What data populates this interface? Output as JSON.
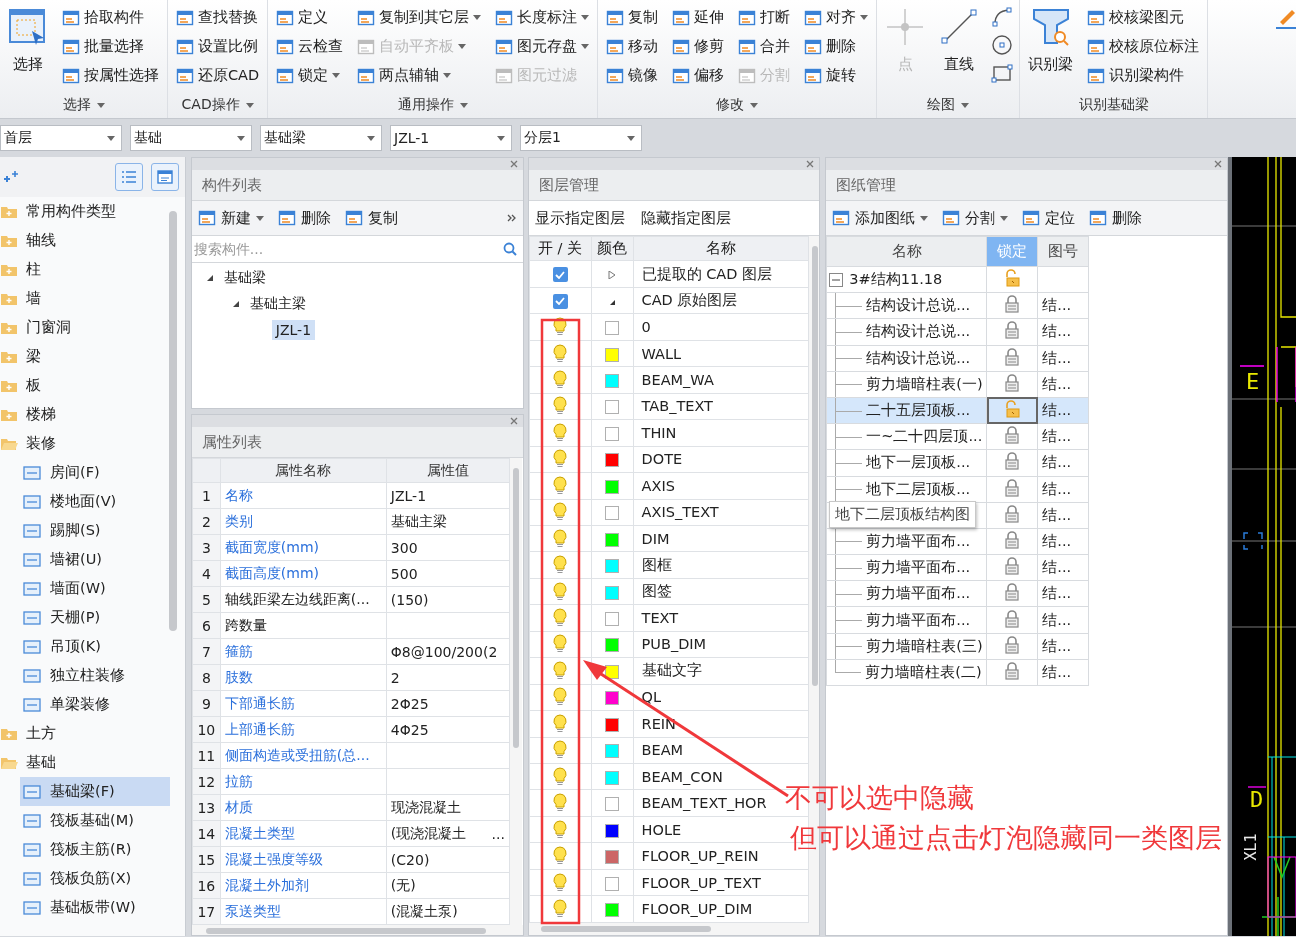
{
  "ribbon": {
    "groups": [
      {
        "label": "选择",
        "menu": true,
        "large": [
          {
            "label": "选择",
            "disabled": false
          }
        ],
        "columns": [
          [
            {
              "kind": "tool",
              "label": "拾取构件",
              "dropdown": false,
              "disabled": false
            },
            {
              "kind": "tool",
              "label": "批量选择",
              "dropdown": false,
              "disabled": false
            },
            {
              "kind": "tool",
              "label": "按属性选择",
              "dropdown": false,
              "disabled": false
            }
          ]
        ]
      },
      {
        "label": "CAD操作",
        "menu": true,
        "columns": [
          [
            {
              "kind": "tool",
              "label": "查找替换",
              "dropdown": false,
              "disabled": false
            },
            {
              "kind": "tool",
              "label": "设置比例",
              "dropdown": false,
              "disabled": false
            },
            {
              "kind": "tool",
              "label": "还原CAD",
              "dropdown": false,
              "disabled": false
            }
          ]
        ]
      },
      {
        "label": "通用操作",
        "menu": true,
        "columns": [
          [
            {
              "kind": "tool",
              "label": "定义",
              "dropdown": false,
              "disabled": false
            },
            {
              "kind": "tool",
              "label": "云检查",
              "dropdown": false,
              "disabled": false
            },
            {
              "kind": "tool",
              "label": "锁定",
              "dropdown": true,
              "disabled": false
            }
          ],
          [
            {
              "kind": "tool",
              "label": "复制到其它层",
              "dropdown": true,
              "disabled": false
            },
            {
              "kind": "tool",
              "label": "自动平齐板",
              "dropdown": true,
              "disabled": true
            },
            {
              "kind": "tool",
              "label": "两点辅轴",
              "dropdown": true,
              "disabled": false
            }
          ],
          [
            {
              "kind": "tool",
              "label": "长度标注",
              "dropdown": true,
              "disabled": false
            },
            {
              "kind": "tool",
              "label": "图元存盘",
              "dropdown": true,
              "disabled": false
            },
            {
              "kind": "tool",
              "label": "图元过滤",
              "dropdown": false,
              "disabled": true
            }
          ]
        ]
      },
      {
        "label": "修改",
        "menu": true,
        "columns": [
          [
            {
              "kind": "tool",
              "label": "复制",
              "dropdown": false,
              "disabled": false
            },
            {
              "kind": "tool",
              "label": "移动",
              "dropdown": false,
              "disabled": false
            },
            {
              "kind": "tool",
              "label": "镜像",
              "dropdown": false,
              "disabled": false
            }
          ],
          [
            {
              "kind": "tool",
              "label": "延伸",
              "dropdown": false,
              "disabled": false
            },
            {
              "kind": "tool",
              "label": "修剪",
              "dropdown": false,
              "disabled": false
            },
            {
              "kind": "tool",
              "label": "偏移",
              "dropdown": false,
              "disabled": false
            }
          ],
          [
            {
              "kind": "tool",
              "label": "打断",
              "dropdown": false,
              "disabled": false
            },
            {
              "kind": "tool",
              "label": "合并",
              "dropdown": false,
              "disabled": false
            },
            {
              "kind": "tool",
              "label": "分割",
              "dropdown": false,
              "disabled": true
            }
          ],
          [
            {
              "kind": "tool",
              "label": "对齐",
              "dropdown": true,
              "disabled": false
            },
            {
              "kind": "tool",
              "label": "删除",
              "dropdown": false,
              "disabled": false
            },
            {
              "kind": "tool",
              "label": "旋转",
              "dropdown": false,
              "disabled": false
            }
          ]
        ]
      },
      {
        "label": "绘图",
        "menu": true,
        "large": [
          {
            "label": "点",
            "disabled": true
          },
          {
            "label": "直线",
            "disabled": false
          }
        ],
        "columns": [
          [
            {
              "kind": "icon"
            },
            {
              "kind": "icon"
            },
            {
              "kind": "icon"
            }
          ]
        ]
      },
      {
        "label": "识别基础梁",
        "menu": false,
        "large": [
          {
            "label": "识别梁",
            "disabled": false
          }
        ],
        "columns": [
          [
            {
              "kind": "tool",
              "label": "校核梁图元",
              "dropdown": false,
              "disabled": false
            },
            {
              "kind": "tool",
              "label": "校核原位标注",
              "dropdown": false,
              "disabled": false
            },
            {
              "kind": "tool",
              "label": "识别梁构件",
              "dropdown": false,
              "disabled": false
            }
          ]
        ]
      }
    ]
  },
  "selectors": [
    "首层",
    "基础",
    "基础梁",
    "JZL-1",
    "分层1"
  ],
  "tree": {
    "items": [
      {
        "label": "常用构件类型",
        "expanded": false,
        "selected": false
      },
      {
        "label": "轴线",
        "expanded": false,
        "selected": false
      },
      {
        "label": "柱",
        "expanded": false,
        "selected": false
      },
      {
        "label": "墙",
        "expanded": false,
        "selected": false
      },
      {
        "label": "门窗洞",
        "expanded": false,
        "selected": false
      },
      {
        "label": "梁",
        "expanded": false,
        "selected": false
      },
      {
        "label": "板",
        "expanded": false,
        "selected": false
      },
      {
        "label": "楼梯",
        "expanded": false,
        "selected": false
      },
      {
        "label": "装修",
        "expanded": true,
        "selected": false,
        "children": [
          {
            "label": "房间(F)",
            "selected": false
          },
          {
            "label": "楼地面(V)",
            "selected": false
          },
          {
            "label": "踢脚(S)",
            "selected": false
          },
          {
            "label": "墙裙(U)",
            "selected": false
          },
          {
            "label": "墙面(W)",
            "selected": false
          },
          {
            "label": "天棚(P)",
            "selected": false
          },
          {
            "label": "吊顶(K)",
            "selected": false
          },
          {
            "label": "独立柱装修",
            "selected": false
          },
          {
            "label": "单梁装修",
            "selected": false
          }
        ]
      },
      {
        "label": "土方",
        "expanded": false,
        "selected": false
      },
      {
        "label": "基础",
        "expanded": true,
        "selected": false,
        "children": [
          {
            "label": "基础梁(F)",
            "selected": true
          },
          {
            "label": "筏板基础(M)",
            "selected": false
          },
          {
            "label": "筏板主筋(R)",
            "selected": false
          },
          {
            "label": "筏板负筋(X)",
            "selected": false
          },
          {
            "label": "基础板带(W)",
            "selected": false
          }
        ]
      }
    ]
  },
  "component_list": {
    "title": "构件列表",
    "toolbar": [
      {
        "label": "新建",
        "dropdown": true
      },
      {
        "label": "删除",
        "dropdown": false
      },
      {
        "label": "复制",
        "dropdown": false
      }
    ],
    "search": {
      "placeholder": "搜索构件..."
    },
    "tree": [
      {
        "label": "基础梁",
        "expanded": true,
        "selected": false,
        "children": [
          {
            "label": "基础主梁",
            "expanded": true,
            "selected": false,
            "children": [
              {
                "label": "JZL-1",
                "selected": true
              }
            ]
          }
        ]
      }
    ]
  },
  "properties": {
    "title": "属性列表",
    "columns": [
      "属性名称",
      "属性值"
    ],
    "rows": [
      {
        "index": "1",
        "name": "名称",
        "value": "JZL-1",
        "public": true
      },
      {
        "index": "2",
        "name": "类别",
        "value": "基础主梁",
        "public": true
      },
      {
        "index": "3",
        "name": "截面宽度(mm)",
        "value": "300",
        "public": true
      },
      {
        "index": "4",
        "name": "截面高度(mm)",
        "value": "500",
        "public": true
      },
      {
        "index": "5",
        "name": "轴线距梁左边线距离(...",
        "value": "(150)",
        "public": false
      },
      {
        "index": "6",
        "name": "跨数量",
        "public": false
      },
      {
        "index": "7",
        "name": "箍筋",
        "value": "Φ8@100/200(2",
        "public": true
      },
      {
        "index": "8",
        "name": "肢数",
        "value": "2",
        "public": true
      },
      {
        "index": "9",
        "name": "下部通长筋",
        "value": "2Φ25",
        "public": true
      },
      {
        "index": "10",
        "name": "上部通长筋",
        "value": "4Φ25",
        "public": true
      },
      {
        "index": "11",
        "name": "侧面构造或受扭筋(总...",
        "public": true
      },
      {
        "index": "12",
        "name": "拉筋",
        "public": true
      },
      {
        "index": "13",
        "name": "材质",
        "value": "现浇混凝土",
        "public": true
      },
      {
        "index": "14",
        "name": "混凝土类型",
        "value": "(现浇混凝土",
        "button": "...",
        "public": true
      },
      {
        "index": "15",
        "name": "混凝土强度等级",
        "value": "(C20)",
        "public": true
      },
      {
        "index": "16",
        "name": "混凝土外加剂",
        "value": "(无)",
        "public": true
      },
      {
        "index": "17",
        "name": "泵送类型",
        "value": "(混凝土泵)",
        "public": true
      }
    ]
  },
  "layers": {
    "title": "图层管理",
    "actions": [
      "显示指定图层",
      "隐藏指定图层"
    ],
    "columns": [
      "开 / 关",
      "颜色",
      "名称"
    ],
    "items": [
      {
        "name": "已提取的 CAD 图层",
        "checked": true,
        "expanded": false
      },
      {
        "name": "CAD 原始图层",
        "checked": true,
        "expanded": true,
        "children": [
          {
            "name": "0",
            "color": "#ffffff",
            "on": true
          },
          {
            "name": "WALL",
            "color": "#ffff00",
            "on": true
          },
          {
            "name": "BEAM_WA",
            "color": "#00ffff",
            "on": true
          },
          {
            "name": "TAB_TEXT",
            "color": "#ffffff",
            "on": true
          },
          {
            "name": "THIN",
            "color": "#ffffff",
            "on": true
          },
          {
            "name": "DOTE",
            "color": "#ff0000",
            "on": true
          },
          {
            "name": "AXIS",
            "color": "#00ff00",
            "on": true
          },
          {
            "name": "AXIS_TEXT",
            "color": "#ffffff",
            "on": true
          },
          {
            "name": "DIM",
            "color": "#00ff00",
            "on": true
          },
          {
            "name": "图框",
            "color": "#00ffff",
            "on": true
          },
          {
            "name": "图签",
            "color": "#00ffff",
            "on": true
          },
          {
            "name": "TEXT",
            "color": "#ffffff",
            "on": true
          },
          {
            "name": "PUB_DIM",
            "color": "#00ff00",
            "on": true
          },
          {
            "name": "基础文字",
            "color": "#ffff00",
            "on": true
          },
          {
            "name": "QL",
            "color": "#ff00cc",
            "on": true
          },
          {
            "name": "REIN",
            "color": "#ff0000",
            "on": true
          },
          {
            "name": "BEAM",
            "color": "#00ffff",
            "on": true
          },
          {
            "name": "BEAM_CON",
            "color": "#00ffff",
            "on": true
          },
          {
            "name": "BEAM_TEXT_HOR",
            "color": "#ffffff",
            "on": true
          },
          {
            "name": "HOLE",
            "color": "#0000ff",
            "on": true
          },
          {
            "name": "FLOOR_UP_REIN",
            "color": "#cc6666",
            "on": true
          },
          {
            "name": "FLOOR_UP_TEXT",
            "color": "#ffffff",
            "on": true
          },
          {
            "name": "FLOOR_UP_DIM",
            "color": "#00ff00",
            "on": true
          }
        ]
      }
    ]
  },
  "drawings": {
    "title": "图纸管理",
    "toolbar": [
      {
        "label": "添加图纸",
        "dropdown": true
      },
      {
        "label": "分割",
        "dropdown": true
      },
      {
        "label": "定位",
        "dropdown": false
      },
      {
        "label": "删除",
        "dropdown": false
      }
    ],
    "columns": [
      {
        "label": "名称",
        "selected": false
      },
      {
        "label": "锁定",
        "selected": true
      },
      {
        "label": "图号",
        "selected": false
      }
    ],
    "root": {
      "name": "3#结构11.18",
      "expanded": true,
      "locked": false,
      "selected": false,
      "children": [
        {
          "name": "结构设计总说...",
          "locked": true,
          "number": "结...",
          "selected": false
        },
        {
          "name": "结构设计总说...",
          "locked": true,
          "number": "结...",
          "selected": false
        },
        {
          "name": "结构设计总说...",
          "locked": true,
          "number": "结...",
          "selected": false
        },
        {
          "name": "剪力墙暗柱表(一)",
          "locked": true,
          "number": "结...",
          "selected": false
        },
        {
          "name": "二十五层顶板...",
          "locked": false,
          "number": "结...",
          "selected": true
        },
        {
          "name": "一~二十四层顶...",
          "locked": true,
          "number": "结...",
          "selected": false
        },
        {
          "name": "地下一层顶板...",
          "locked": true,
          "number": "结...",
          "selected": false
        },
        {
          "name": "地下二层顶板...",
          "locked": true,
          "number": "结...",
          "selected": false
        },
        {
          "tooltip": "地下二层顶板结构图",
          "locked": true,
          "number": "结...",
          "selected": false
        },
        {
          "name": "剪力墙平面布...",
          "locked": true,
          "number": "结...",
          "selected": false
        },
        {
          "name": "剪力墙平面布...",
          "locked": true,
          "number": "结...",
          "selected": false
        },
        {
          "name": "剪力墙平面布...",
          "locked": true,
          "number": "结...",
          "selected": false
        },
        {
          "name": "剪力墙平面布...",
          "locked": true,
          "number": "结...",
          "selected": false
        },
        {
          "name": "剪力墙暗柱表(三)",
          "locked": true,
          "number": "结...",
          "selected": false
        },
        {
          "name": "剪力墙暗柱表(二)",
          "locked": true,
          "number": "结...",
          "selected": false
        }
      ]
    }
  },
  "canvas": {
    "labels": [
      {
        "text": "E",
        "rotated": false
      },
      {
        "text": "D",
        "rotated": false
      },
      {
        "text": "XL1",
        "rotated": true
      }
    ]
  },
  "annotation": {
    "lines": [
      "不可以选中隐藏",
      "但可以通过点击灯泡隐藏同一类图层"
    ]
  }
}
